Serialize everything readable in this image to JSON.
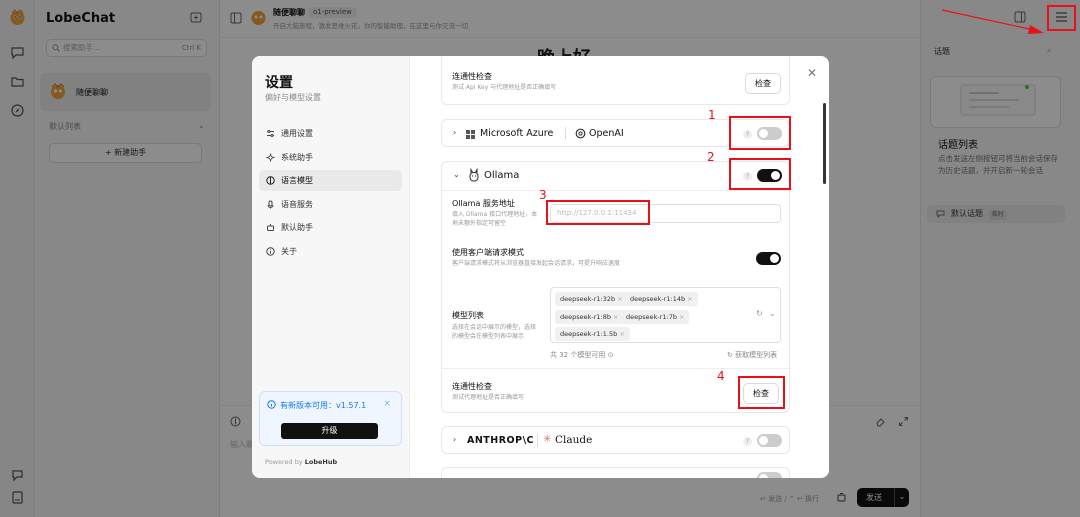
{
  "app": {
    "brand": "LobeChat"
  },
  "sidebar": {
    "search_placeholder": "搜索助手...",
    "search_shortcut": "Ctrl K",
    "agent_name": "随便聊聊",
    "group_label": "默认列表",
    "new_group_label": "+ 新建助手"
  },
  "chat": {
    "agent_name": "随便聊聊",
    "model": "o1-preview",
    "description": "开启大脑旅程，激发思维火花。你的智能助理，在这里与你交流一切",
    "greeting": "晚上好",
    "input_placeholder": "输入聊天内容...",
    "hint": "↵ 发送 / ⌃ ↵ 换行",
    "send_label": "发送"
  },
  "right_panel": {
    "title": "话题",
    "heading": "话题列表",
    "description": "点击发送左侧按钮可将当前会话保存为历史话题，并开启新一轮会话",
    "default_topic": "默认话题",
    "default_topic_tag": "临时"
  },
  "settings": {
    "title": "设置",
    "subtitle": "偏好与模型设置",
    "nav": [
      {
        "label": "通用设置",
        "icon": "sliders-icon"
      },
      {
        "label": "系统助手",
        "icon": "sparkles-icon"
      },
      {
        "label": "语言模型",
        "icon": "brain-icon",
        "active": true
      },
      {
        "label": "语音服务",
        "icon": "mic-icon"
      },
      {
        "label": "默认助手",
        "icon": "bot-icon"
      },
      {
        "label": "关于",
        "icon": "info-icon"
      }
    ],
    "update_text": "有新版本可用：v1.57.1",
    "update_button": "升级",
    "powered_by_prefix": "Powered by",
    "powered_by_brand": "LobeHub"
  },
  "providers": {
    "top_check": {
      "label": "连通性检查",
      "desc": "测试 Api Key 与代理地址是否正确填写",
      "button": "检查"
    },
    "azure": {
      "name": "Microsoft Azure",
      "name2": "OpenAI",
      "enabled": false
    },
    "ollama": {
      "name": "Ollama",
      "enabled": true,
      "endpoint_label": "Ollama 服务地址",
      "endpoint_desc": "填入 Ollama 接口代理地址，本地未额外指定可留空",
      "endpoint_placeholder": "http://127.0.0.1:11434",
      "client_mode_label": "使用客户端请求模式",
      "client_mode_desc": "客户端请求模式将从浏览器直接发起会话请求，可提升响应速度",
      "client_mode_enabled": true,
      "model_list_label": "模型列表",
      "model_list_desc": "选择在会话中展示的模型，选择的模型会在模型列表中展示",
      "models": [
        "deepseek-r1:32b",
        "deepseek-r1:14b",
        "deepseek-r1:8b",
        "deepseek-r1:7b",
        "deepseek-r1:1.5b"
      ],
      "models_available": "共 32 个模型可用",
      "fetch_models": "获取模型列表",
      "check_label": "连通性检查",
      "check_desc": "测试代理地址是否正确填写",
      "check_button": "检查"
    },
    "anthropic": {
      "name": "ANTHROP\\C",
      "name2": "Claude",
      "enabled": false
    }
  },
  "annotations": [
    "1",
    "2",
    "3",
    "4"
  ],
  "colors": {
    "annotation_red": "#e8101a",
    "update_blue": "#1677ff"
  }
}
